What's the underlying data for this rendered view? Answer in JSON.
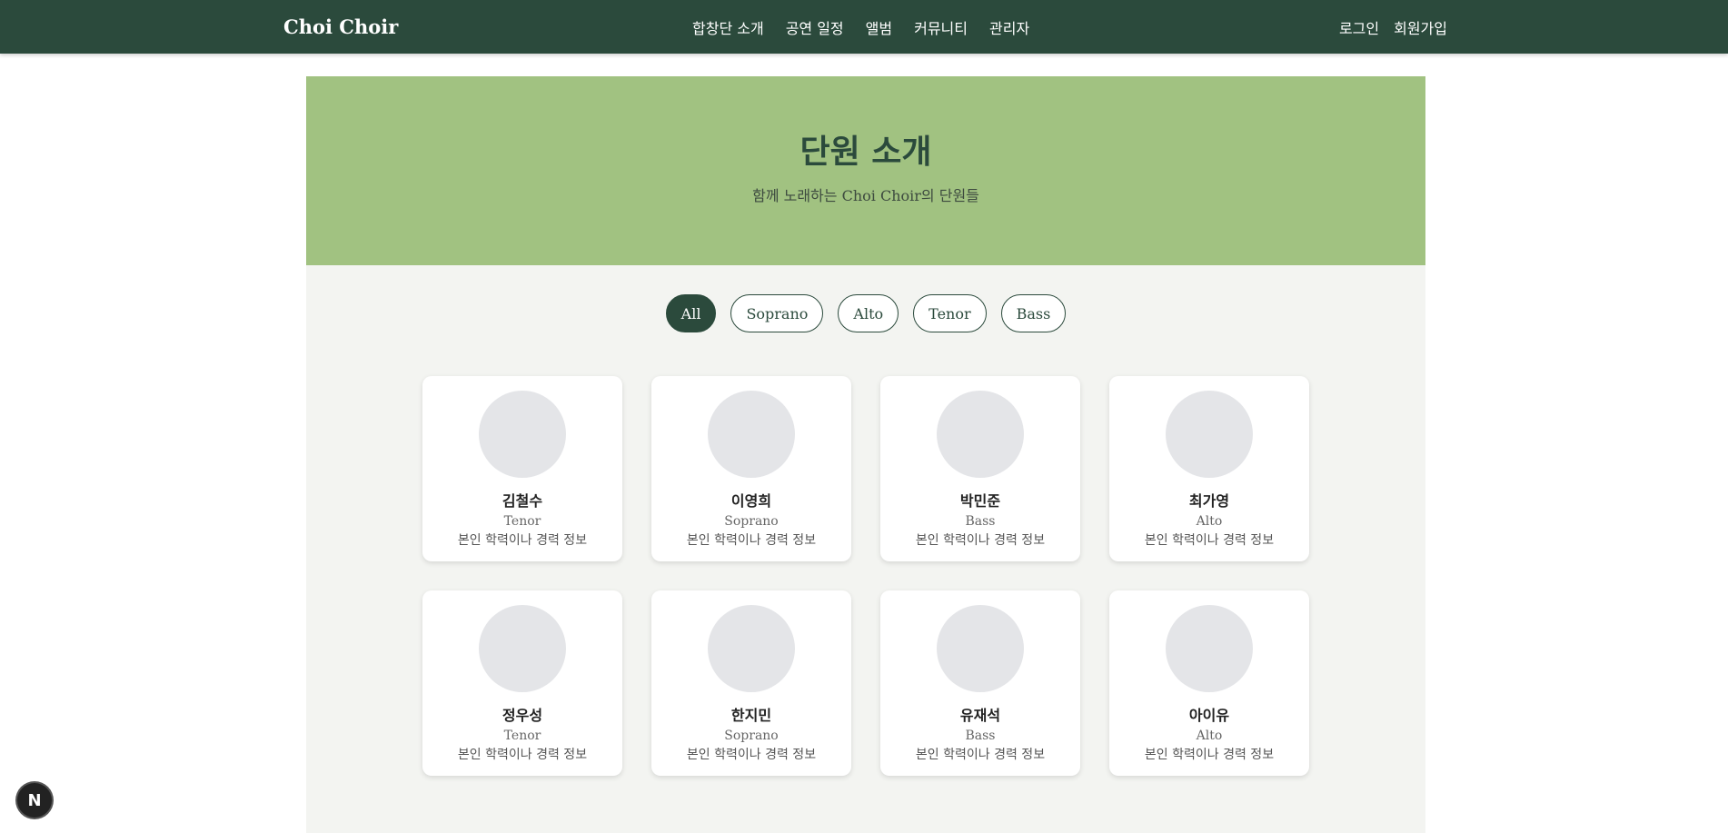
{
  "nav": {
    "brand": "Choi Choir",
    "links": [
      "합창단 소개",
      "공연 일정",
      "앨범",
      "커뮤니티",
      "관리자"
    ],
    "login": "로그인",
    "signup": "회원가입"
  },
  "hero": {
    "title": "단원 소개",
    "subtitle": "함께 노래하는 Choi Choir의 단원들"
  },
  "filters": [
    "All",
    "Soprano",
    "Alto",
    "Tenor",
    "Bass"
  ],
  "members": [
    {
      "name": "김철수",
      "part": "Tenor",
      "bio": "본인 학력이나 경력 정보"
    },
    {
      "name": "이영희",
      "part": "Soprano",
      "bio": "본인 학력이나 경력 정보"
    },
    {
      "name": "박민준",
      "part": "Bass",
      "bio": "본인 학력이나 경력 정보"
    },
    {
      "name": "최가영",
      "part": "Alto",
      "bio": "본인 학력이나 경력 정보"
    },
    {
      "name": "정우성",
      "part": "Tenor",
      "bio": "본인 학력이나 경력 정보"
    },
    {
      "name": "한지민",
      "part": "Soprano",
      "bio": "본인 학력이나 경력 정보"
    },
    {
      "name": "유재석",
      "part": "Bass",
      "bio": "본인 학력이나 경력 정보"
    },
    {
      "name": "아이유",
      "part": "Alto",
      "bio": "본인 학력이나 경력 정보"
    }
  ],
  "badge": {
    "letter": "N"
  },
  "colors": {
    "primary": "#2b4a3c",
    "hero_bg": "#a1c281",
    "page_bg": "#f3f4f1",
    "avatar": "#e4e5e8"
  }
}
